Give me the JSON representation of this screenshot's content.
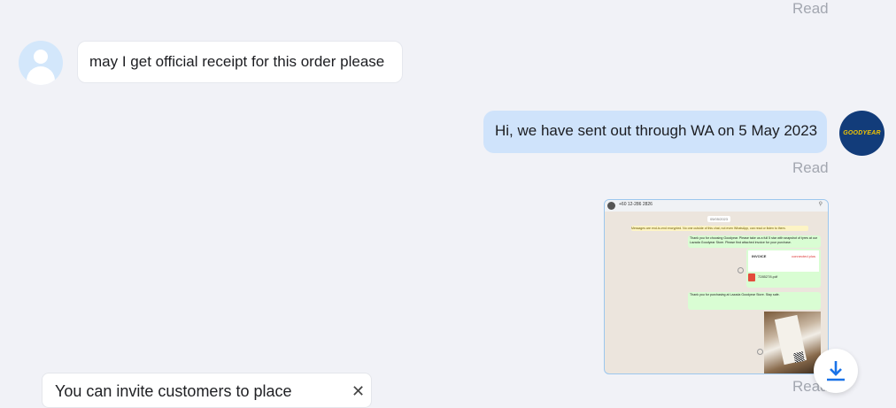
{
  "messages": [
    {
      "type": "status",
      "read_label": "Read"
    },
    {
      "type": "incoming",
      "text": "may I get official receipt for this order please"
    },
    {
      "type": "outgoing",
      "text": "Hi, we have sent out through WA on 5 May 2023",
      "read_label": "Read",
      "avatar_brand": "GOODYEAR"
    },
    {
      "type": "outgoing-image",
      "read_label": "Read",
      "screenshot": {
        "phone": "+60 12-286 2826",
        "notice": "Messages are end-to-end encrypted. No one outside of this chat, not even WhatsApp, can read or listen to them.",
        "message1": "Thank you for choosing Goodyear. Please take us a full 5 star with snapshot of tyres at our Lazada Goodyear Store. Please find attached invoice for your purchase.",
        "invoice_title": "INVOICE",
        "invoice_brand": "connected plus",
        "pdf_name": "7285278.pdf",
        "message2": "Thank you for purchasing at Lazada Goodyear Store. Stay safe."
      }
    }
  ],
  "invite_card": {
    "text": "You can invite customers to place",
    "close_icon": "close-icon"
  },
  "colors": {
    "background": "#f1f2f7",
    "outgoing_bubble": "#cfe3fb",
    "incoming_bubble": "#ffffff",
    "read_text": "#a3a7b0",
    "accent": "#1a73e8"
  }
}
